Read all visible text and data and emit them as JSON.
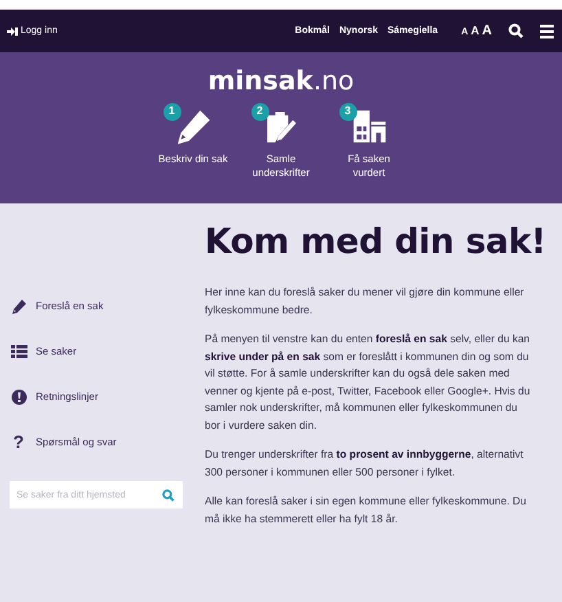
{
  "top_bar": {
    "login": "Logg inn",
    "languages": [
      "Bokmål",
      "Nynorsk",
      "Sámegiella"
    ],
    "font_sizes": [
      "A",
      "A",
      "A"
    ]
  },
  "header": {
    "logo_bold": "minsak",
    "logo_rest": ".no",
    "steps": [
      {
        "number": "1",
        "label": "Beskriv din sak",
        "kind": "pencil"
      },
      {
        "number": "2",
        "label": "Samle underskrifter",
        "kind": "clipboard"
      },
      {
        "number": "3",
        "label": "Få saken vurdert",
        "kind": "buildings"
      }
    ]
  },
  "sidebar": {
    "items": [
      {
        "label": "Foreslå en sak",
        "kind": "pencil"
      },
      {
        "label": "Se saker",
        "kind": "list"
      },
      {
        "label": "Retningslinjer",
        "kind": "alert"
      },
      {
        "label": "Spørsmål og svar",
        "kind": "question",
        "glyph": "?"
      }
    ],
    "search": {
      "placeholder": "Se saker fra ditt hjemsted"
    }
  },
  "main": {
    "title": "Kom med din sak!",
    "paragraphs": [
      "Her inne kan du foreslå saker du mener vil gjøre din kommune eller fylkeskommune bedre.",
      "På menyen til venstre kan du enten **foreslå en sak** selv, eller du kan **skrive under på en sak** som er foreslått i kommunen din og som du vil støtte. For å samle underskrifter kan du også dele saken med venner og kjente på e-post, Twitter, Facebook eller Google+. Hvis du samler nok underskrifter, må kommunen eller fylkeskommunen du bor i vurdere saken din.",
      "Du trenger underskrifter fra **to prosent av innbyggerne**, alternativt 300 personer i kommunen eller 500 personer i fylket.",
      "Alle kan foreslå saker i sin egen kommune eller fylkeskommune. Du må ikke ha stemmerett eller ha fylt 18 år."
    ]
  }
}
